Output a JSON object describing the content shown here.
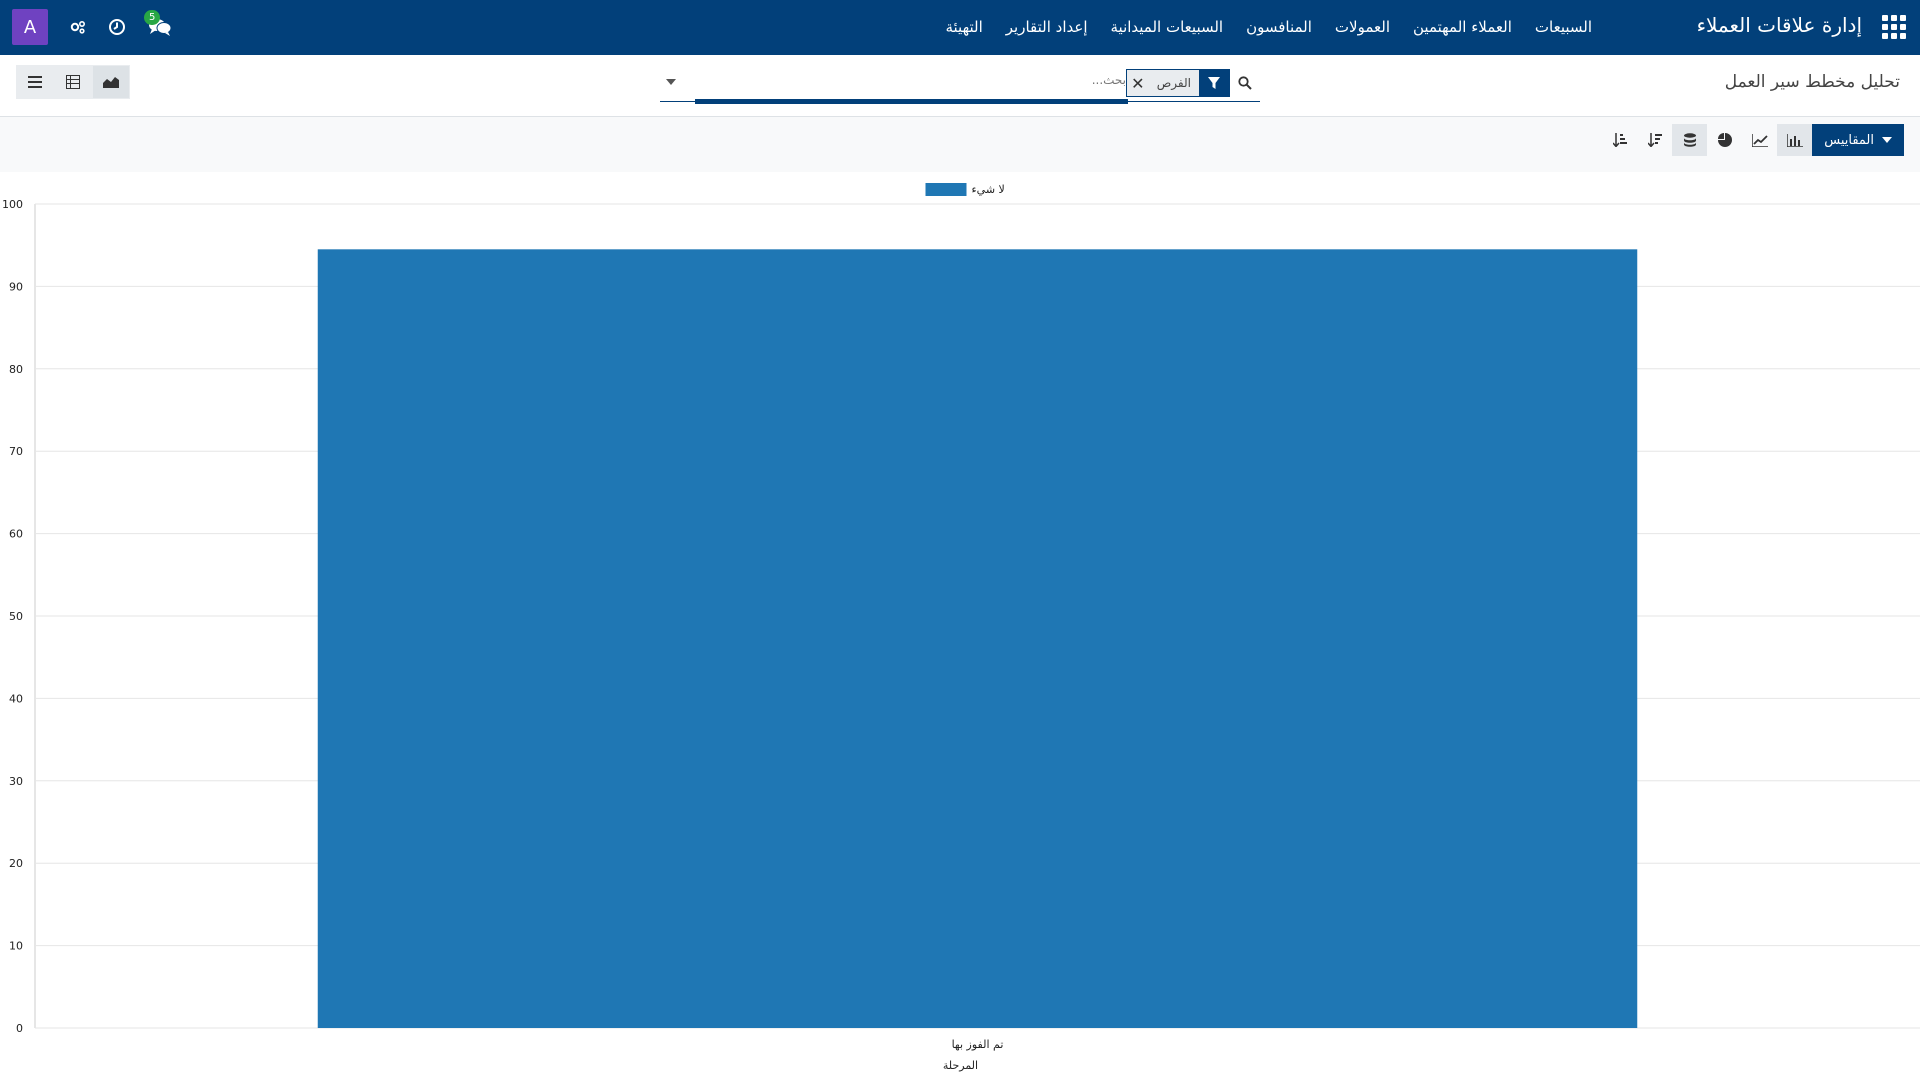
{
  "nav": {
    "app_title": "إدارة علاقات العملاء",
    "menu": [
      "السبيعات",
      "العملاء المهتمين",
      "العمولات",
      "المنافسون",
      "السبيعات الميدانية",
      "إعداد التقارير",
      "التهيئة"
    ],
    "avatar_letter": "A",
    "messages_count": "5"
  },
  "control_panel": {
    "breadcrumb": "تحليل مخطط سير العمل",
    "search": {
      "facet_value": "الفرص",
      "placeholder": "بحث..."
    }
  },
  "graph_toolbar": {
    "measures_label": "المقاييس"
  },
  "colors": {
    "navbar": "#02407a",
    "bar": "#1f77b4",
    "avatar": "#6f42c1"
  },
  "chart_data": {
    "type": "bar",
    "categories": [
      "تم الفوز بها"
    ],
    "series": [
      {
        "name": "لا شيء",
        "values": [
          94.5
        ]
      }
    ],
    "xlabel": "المرحلة",
    "ylabel": "",
    "ylim": [
      0,
      100
    ],
    "yticks": [
      0,
      10,
      20,
      30,
      40,
      50,
      60,
      70,
      80,
      90,
      100
    ],
    "grid": true,
    "legend": "top-center"
  }
}
